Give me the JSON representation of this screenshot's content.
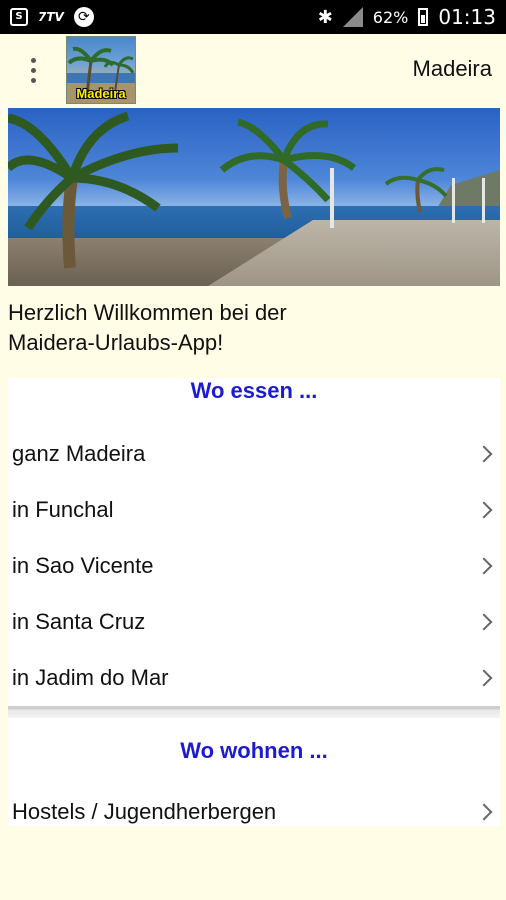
{
  "status_bar": {
    "icon1": "S",
    "icon2": "7TV",
    "icon3": "sync-icon",
    "bluetooth_icon": "bluetooth-icon",
    "battery_percent": "62%",
    "time": "01:13"
  },
  "app_bar": {
    "logo_text": "Madeira",
    "title": "Madeira"
  },
  "welcome": {
    "line1": "Herzlich Willkommen bei der",
    "line2": "Maidera-Urlaubs-App!"
  },
  "sections": {
    "essen": {
      "header": "Wo essen ...",
      "items": [
        "ganz Madeira",
        "in Funchal",
        "in Sao Vicente",
        "in Santa Cruz",
        "in Jadim do Mar"
      ]
    },
    "wohnen": {
      "header": "Wo wohnen ...",
      "items": [
        "Hostels / Jugendherbergen"
      ]
    }
  },
  "colors": {
    "background": "#fffde6",
    "header_text": "#1b1bd0"
  }
}
